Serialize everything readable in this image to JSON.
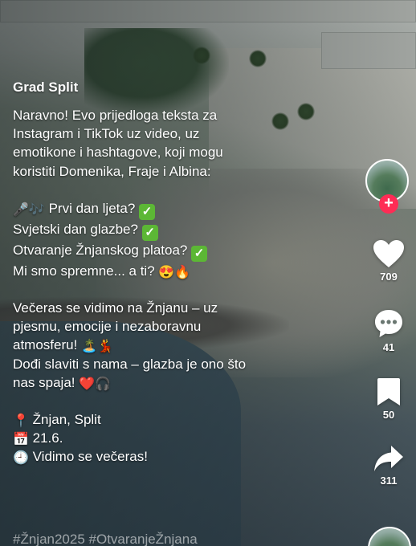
{
  "post": {
    "author": "Grad Split",
    "intro_lines": [
      "Naravno! Evo prijedloga teksta za",
      "Instagram i TikTok uz video, uz",
      "emotikone i hashtagove, koji mogu",
      "koristiti Domenika, Fraje i Albina:"
    ],
    "list": {
      "line1_emoji": "🎤🎶",
      "line1_text": " Prvi dan ljeta? ",
      "line2_text": "Svjetski dan glazbe? ",
      "line3_text": "Otvaranje Žnjanskog platoa? ",
      "line4_text": "Mi smo spremne... a ti? ",
      "line4_emoji": "😍🔥",
      "check_glyph": "✓"
    },
    "body": {
      "line1": "Večeras se vidimo na Žnjanu – uz",
      "line2": "pjesmu, emocije i nezaboravnu",
      "line3": "atmosferu! ",
      "line3_emoji": "🏝️💃",
      "line4": "Dođi slaviti s nama – glazba je ono što",
      "line5": "nas spaja! ",
      "line5_emoji": "❤️🎧"
    },
    "details": {
      "location_emoji": "📍",
      "location": " Žnjan, Split",
      "date_emoji": "📅",
      "date": " 21.6.",
      "time_emoji": "🕘",
      "time": " Vidimo se večeras!"
    },
    "hashtags": "#Žnjan2025 #OtvaranjeŽnjana"
  },
  "rail": {
    "follow_label": "+",
    "likes": "709",
    "comments": "41",
    "saves": "50",
    "shares": "311"
  },
  "colors": {
    "follow_accent": "#fe2c55",
    "check_green": "#5cb735"
  }
}
